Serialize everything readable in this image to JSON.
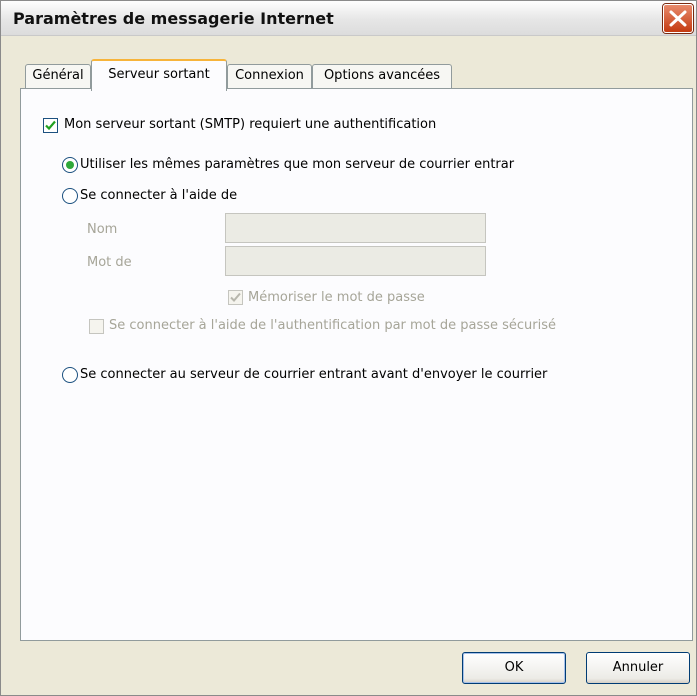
{
  "window": {
    "title": "Paramètres de messagerie Internet"
  },
  "tabs": [
    {
      "label": "Général"
    },
    {
      "label": "Serveur sortant"
    },
    {
      "label": "Connexion"
    },
    {
      "label": "Options avancées"
    }
  ],
  "outgoing": {
    "smtp_auth_label": "Mon serveur sortant (SMTP) requiert une authentification",
    "smtp_auth_checked": true,
    "option_same_settings": "Utiliser les mêmes paramètres que mon serveur de courrier entrar",
    "option_connect_with": "Se connecter à l'aide de",
    "name_label": "Nom",
    "name_value": "",
    "password_label": "Mot de",
    "password_value": "",
    "remember_password_label": "Mémoriser le mot de passe",
    "remember_password_checked": true,
    "spa_label": "Se connecter à l'aide de l'authentification par mot de passe sécurisé",
    "spa_checked": false,
    "option_incoming_first": "Se connecter au serveur de courrier entrant avant d'envoyer le courrier",
    "selected_option": "same_settings"
  },
  "buttons": {
    "ok": "OK",
    "cancel": "Annuler"
  }
}
